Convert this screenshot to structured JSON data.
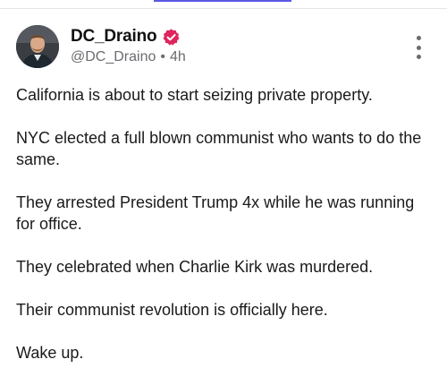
{
  "post": {
    "author": {
      "display_name": "DC_Draino",
      "handle": "@DC_Draino",
      "separator": "•",
      "time_ago": "4h",
      "verified_badge": "verified-check-icon",
      "verified_color": "#e0245e"
    },
    "menu_icon": "more-vertical-icon",
    "paragraphs": [
      "California is about to start seizing private property.",
      "NYC elected a full blown communist who wants to do the same.",
      "They arrested President Trump 4x while he was running for office.",
      "They celebrated when Charlie Kirk was murdered.",
      "Their communist revolution is officially here.",
      "Wake up."
    ]
  },
  "colors": {
    "tab_indicator": "#5b57e6",
    "secondary_text": "#6b6b70"
  }
}
